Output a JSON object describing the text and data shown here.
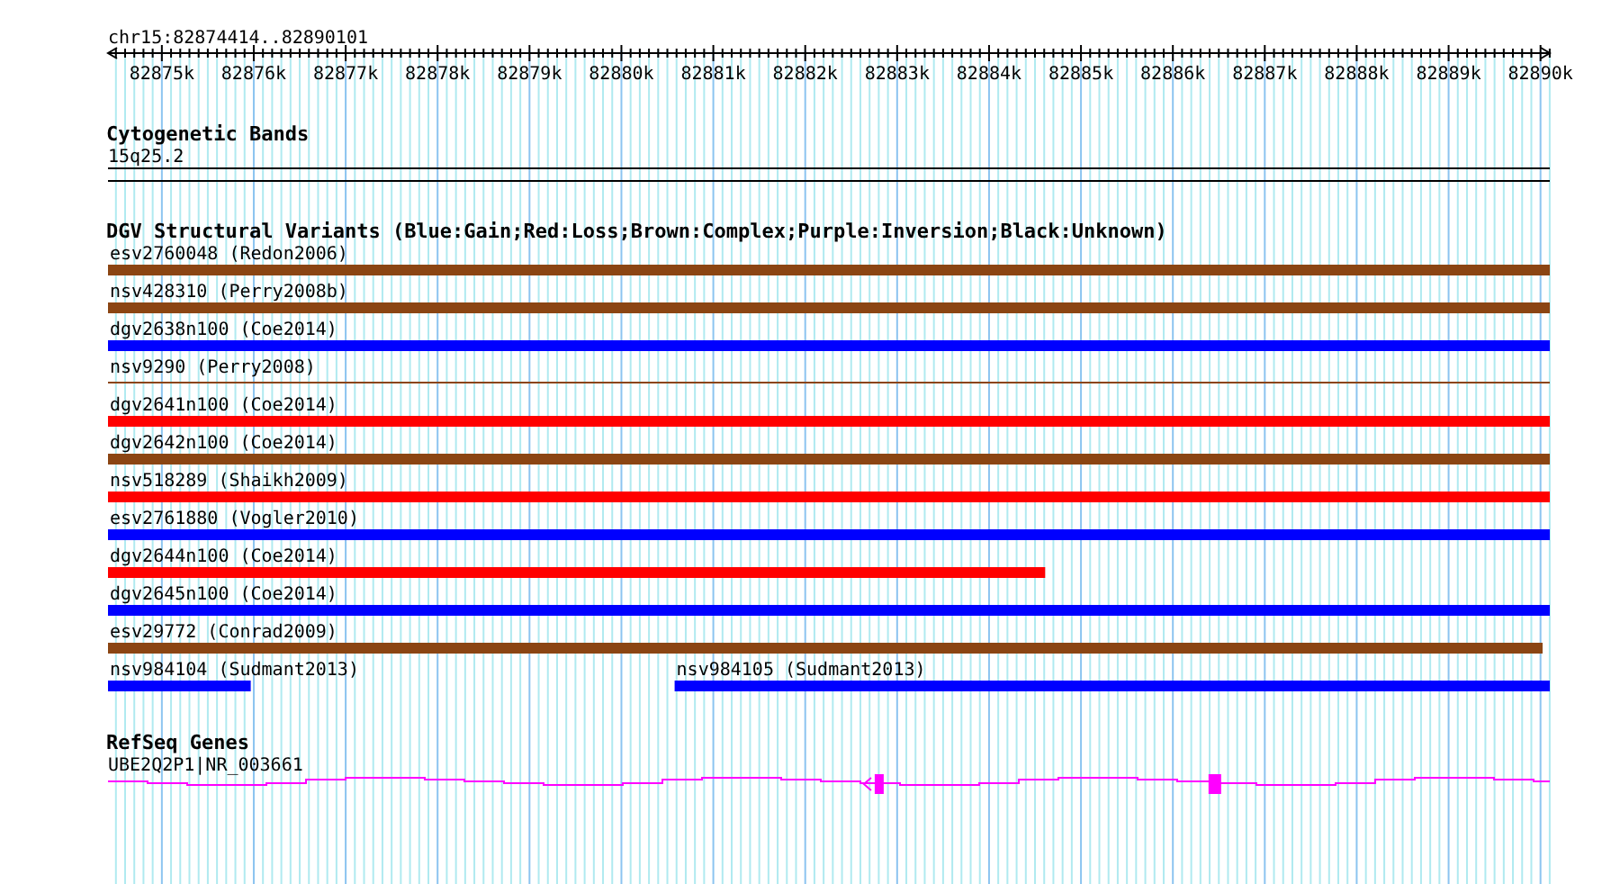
{
  "region": {
    "label": "chr15:82874414..82890101"
  },
  "ruler": {
    "ticks": [
      "82875k",
      "82876k",
      "82877k",
      "82878k",
      "82879k",
      "82880k",
      "82881k",
      "82882k",
      "82883k",
      "82884k",
      "82885k",
      "82886k",
      "82887k",
      "82888k",
      "82889k",
      "82890k"
    ]
  },
  "cytogenetic_bands": {
    "title": "Cytogenetic Bands",
    "bands": [
      {
        "name": "15q25.2"
      }
    ]
  },
  "structural_variants": {
    "title": "DGV Structural Variants (Blue:Gain;Red:Loss;Brown:Complex;Purple:Inversion;Black:Unknown)",
    "rows": [
      {
        "features": [
          {
            "label": "esv2760048 (Redon2006)",
            "color": "#8b4513",
            "kind": "bar",
            "level": 1
          }
        ]
      },
      {
        "features": [
          {
            "label": "nsv428310 (Perry2008b)",
            "color": "#8b4513",
            "kind": "bar",
            "level": 1
          }
        ]
      },
      {
        "features": [
          {
            "label": "dgv2638n100 (Coe2014)",
            "color": "#0000ff",
            "kind": "bar",
            "level": 1
          }
        ]
      },
      {
        "features": [
          {
            "label": "nsv9290 (Perry2008)",
            "color": "#8b4513",
            "kind": "line",
            "level": 1
          }
        ]
      },
      {
        "features": [
          {
            "label": "dgv2641n100 (Coe2014)",
            "color": "#ff0000",
            "kind": "bar",
            "level": 1
          }
        ]
      },
      {
        "features": [
          {
            "label": "dgv2642n100 (Coe2014)",
            "color": "#8b4513",
            "kind": "bar",
            "level": 1
          }
        ]
      },
      {
        "features": [
          {
            "label": "nsv518289 (Shaikh2009)",
            "color": "#ff0000",
            "kind": "bar",
            "level": 1
          }
        ]
      },
      {
        "features": [
          {
            "label": "esv2761880 (Vogler2010)",
            "color": "#0000ff",
            "kind": "bar",
            "level": 1
          }
        ]
      },
      {
        "features": [
          {
            "label": "dgv2644n100 (Coe2014)",
            "color": "#ff0000",
            "kind": "bar",
            "anchored_right": false,
            "level": 0.65
          }
        ]
      },
      {
        "features": [
          {
            "label": "dgv2645n100 (Coe2014)",
            "color": "#0000ff",
            "kind": "bar",
            "level": 1
          }
        ]
      },
      {
        "features": [
          {
            "label": "esv29772 (Conrad2009)",
            "color": "#8b4513",
            "kind": "bar",
            "anchored_right": false,
            "level": 0.995
          }
        ]
      },
      {
        "features": [
          {
            "label": "nsv984104 (Sudmant2013)",
            "color": "#0000ff",
            "kind": "bar",
            "anchored_right": false,
            "level": 0.099
          },
          {
            "label": "nsv984105 (Sudmant2013)",
            "color": "#0000ff",
            "kind": "bar",
            "anchored_right": true,
            "level": 0.607
          }
        ]
      }
    ]
  },
  "refseq_genes": {
    "title": "RefSeq Genes",
    "genes": [
      {
        "label": "UBE2Q2P1|NR_003661"
      }
    ]
  }
}
